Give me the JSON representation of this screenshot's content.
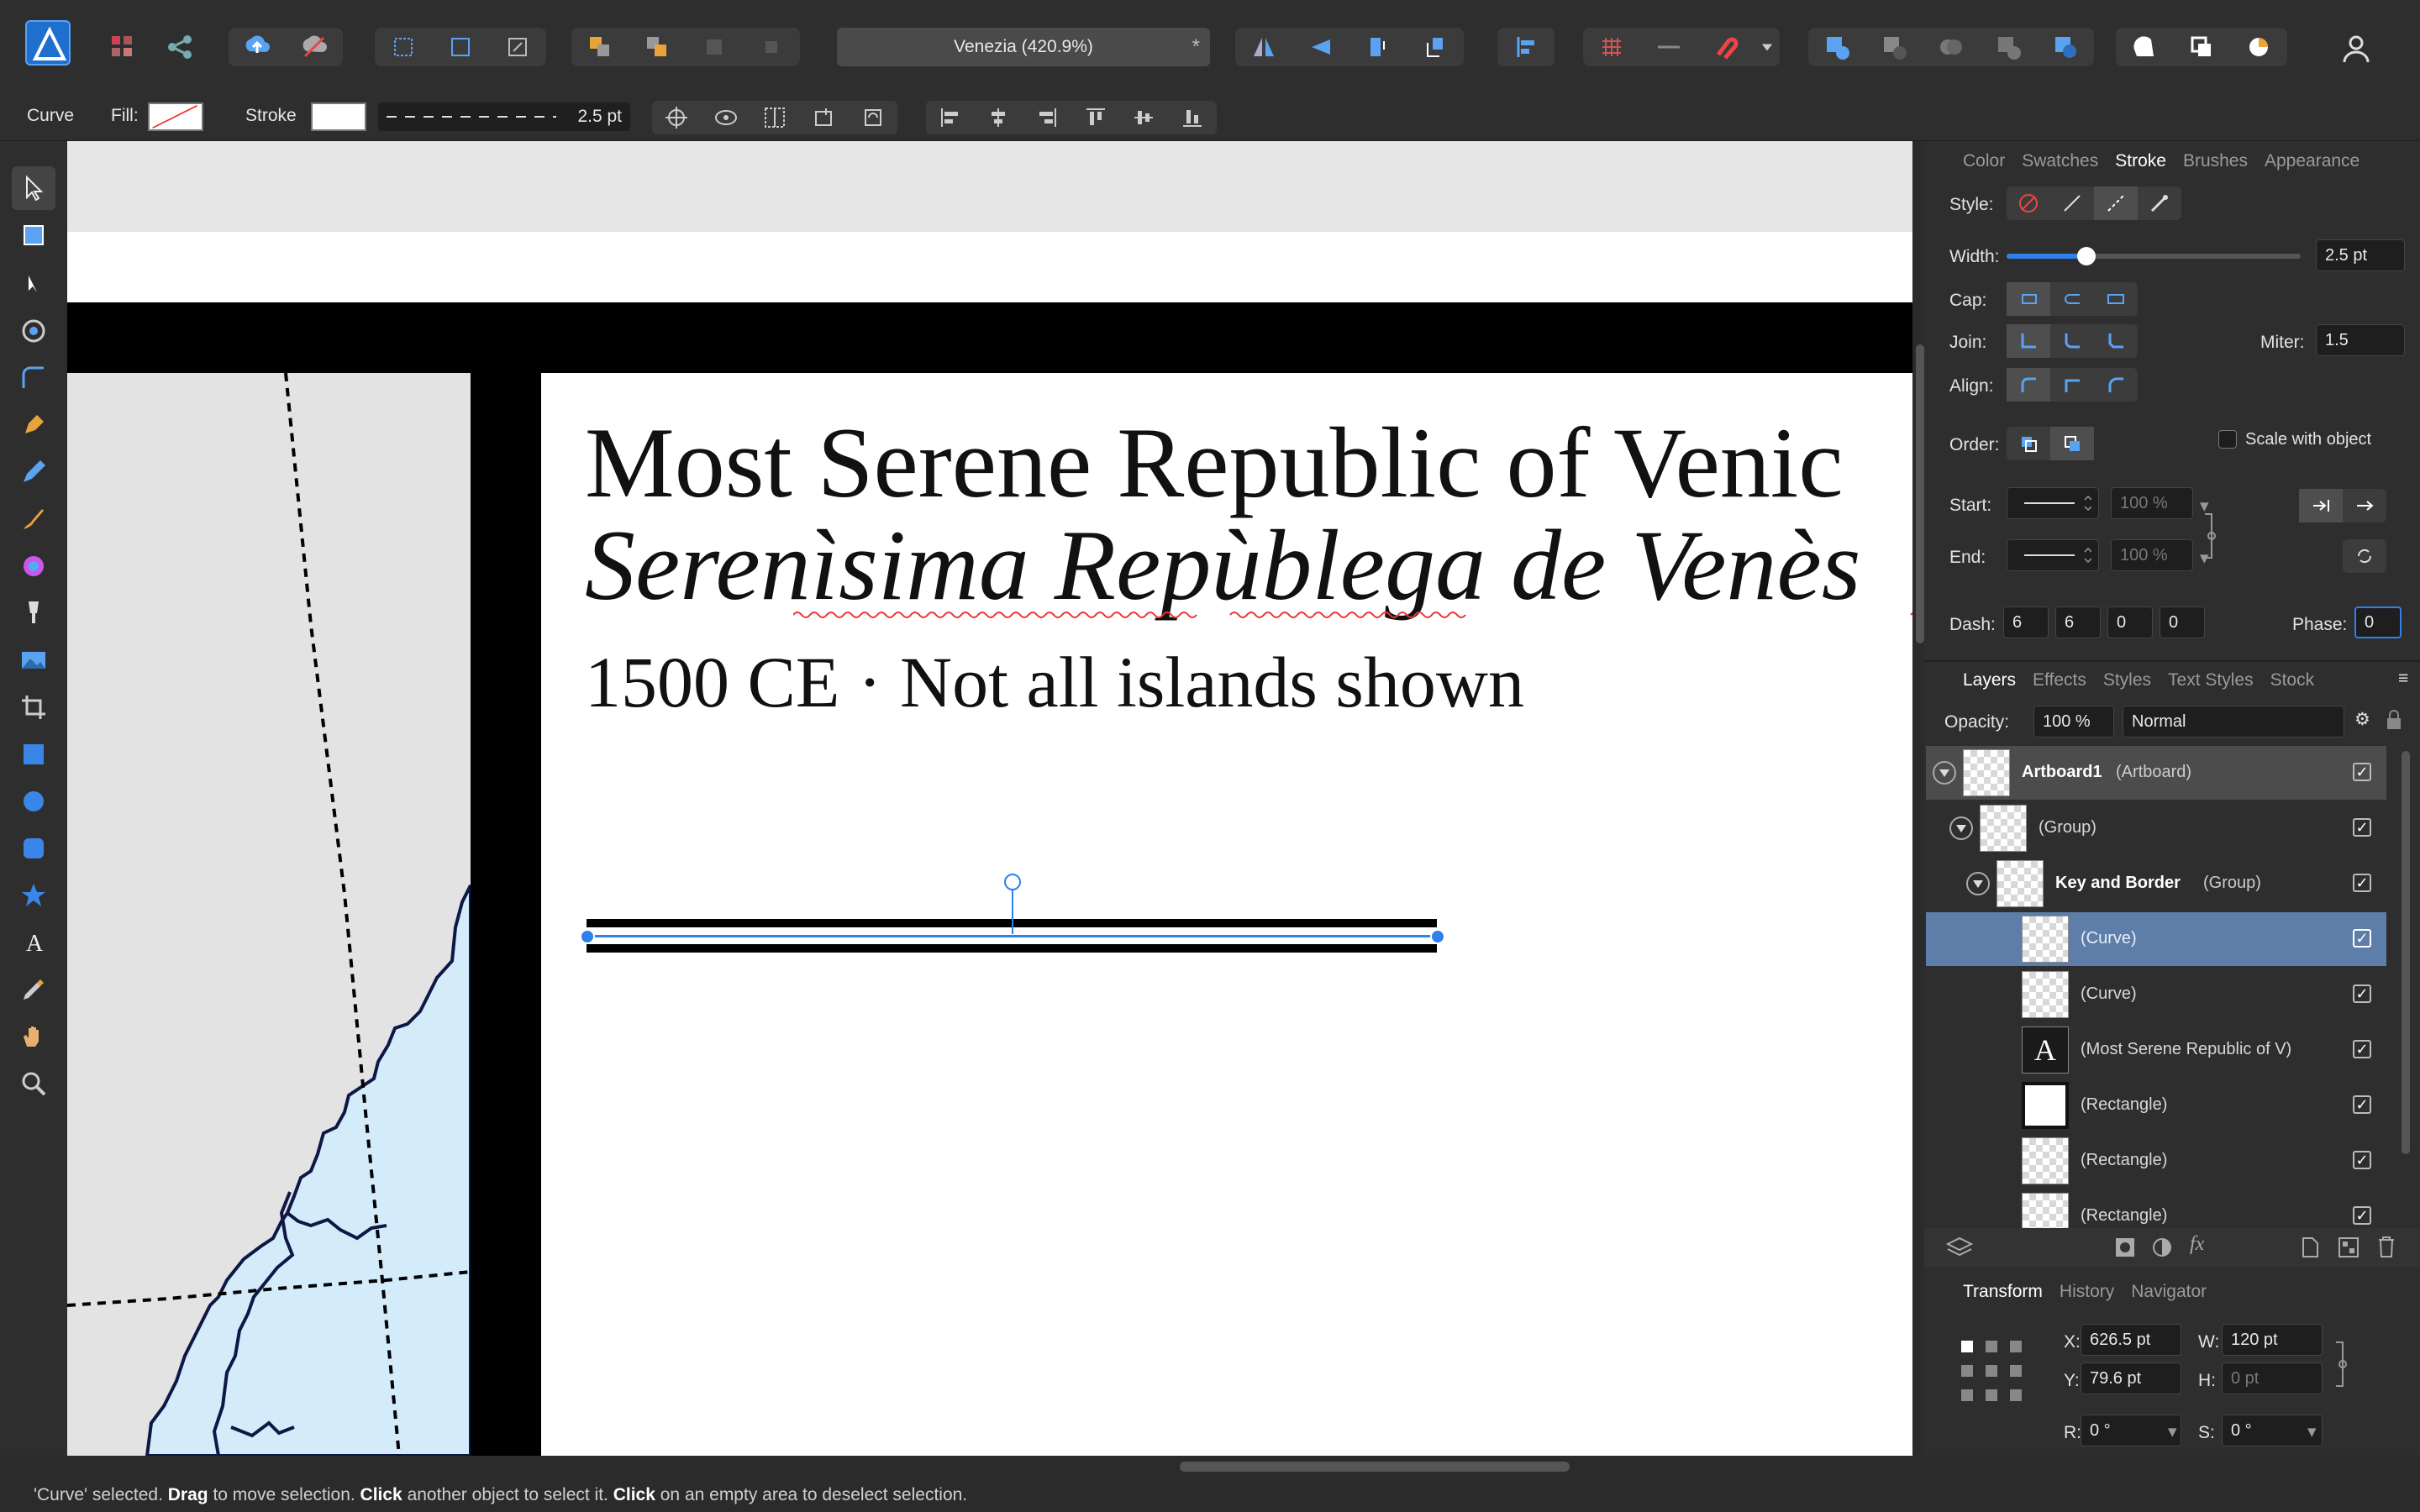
{
  "app": {
    "document_title": "Venezia (420.9%)",
    "modified_marker": "*"
  },
  "context": {
    "tool": "Curve",
    "fill_label": "Fill:",
    "stroke_label": "Stroke",
    "stroke_width": "2.5 pt"
  },
  "canvas": {
    "title": "Most Serene Republic of Venic",
    "subtitle": "Serenìsima Repùblega de Venès",
    "caption": "1500 CE · Not all islands shown"
  },
  "stroke_panel": {
    "tabs": [
      "Color",
      "Swatches",
      "Stroke",
      "Brushes",
      "Appearance"
    ],
    "active_tab": "Stroke",
    "style_label": "Style:",
    "width_label": "Width:",
    "width_value": "2.5 pt",
    "width_fraction": 0.27,
    "cap_label": "Cap:",
    "join_label": "Join:",
    "miter_label": "Miter:",
    "miter_value": "1.5",
    "align_label": "Align:",
    "order_label": "Order:",
    "scale_label": "Scale with object",
    "start_label": "Start:",
    "end_label": "End:",
    "start_pct": "100 %",
    "end_pct": "100 %",
    "dash_label": "Dash:",
    "dash_values": [
      "6",
      "6",
      "0",
      "0"
    ],
    "phase_label": "Phase:",
    "phase_value": "0"
  },
  "layers_panel": {
    "tabs": [
      "Layers",
      "Effects",
      "Styles",
      "Text Styles",
      "Stock"
    ],
    "active_tab": "Layers",
    "opacity_label": "Opacity:",
    "opacity_value": "100 %",
    "blend_mode": "Normal",
    "layers": [
      {
        "name": "Artboard1",
        "type": "(Artboard)"
      },
      {
        "name": "",
        "type": "(Group)"
      },
      {
        "name": "Key and Border",
        "type": "(Group)"
      },
      {
        "name": "",
        "type": "(Curve)"
      },
      {
        "name": "",
        "type": "(Curve)"
      },
      {
        "name": "",
        "type": "(Most Serene Republic of V)"
      },
      {
        "name": "",
        "type": "(Rectangle)"
      },
      {
        "name": "",
        "type": "(Rectangle)"
      },
      {
        "name": "",
        "type": "(Rectangle)"
      }
    ],
    "text_glyph": "A"
  },
  "transform_panel": {
    "tabs": [
      "Transform",
      "History",
      "Navigator"
    ],
    "active_tab": "Transform",
    "x_label": "X:",
    "x_value": "626.5 pt",
    "y_label": "Y:",
    "y_value": "79.6 pt",
    "w_label": "W:",
    "w_value": "120 pt",
    "h_label": "H:",
    "h_value": "0 pt",
    "r_label": "R:",
    "r_value": "0 °",
    "s_label": "S:",
    "s_value": "0 °"
  },
  "status": {
    "selected": "'Curve' selected.",
    "drag": "Drag",
    "drag_text": "to move selection.",
    "click1": "Click",
    "click1_text": "another object to select it.",
    "click2": "Click",
    "click2_text": "on an empty area to deselect selection."
  },
  "colors": {
    "accent": "#2f80ed",
    "selection_row": "#5c7ea8",
    "sea": "#d4ecfa",
    "coast": "#0d1846"
  }
}
